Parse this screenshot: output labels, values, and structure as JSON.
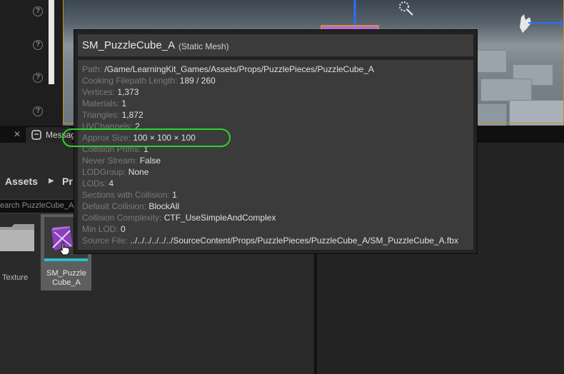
{
  "message_tab": {
    "label": "Messag"
  },
  "breadcrumb": {
    "root": "Assets",
    "next": "Pr"
  },
  "search": {
    "text": "earch PuzzleCube_A"
  },
  "content_items": {
    "texture_label": "Texture",
    "asset_label": "SM_Puzzle Cube_A"
  },
  "tooltip": {
    "title": "SM_PuzzleCube_A",
    "type": "(Static Mesh)",
    "rows": [
      {
        "key": "Path:",
        "value": "/Game/LearningKit_Games/Assets/Props/PuzzlePieces/PuzzleCube_A"
      },
      {
        "key": "Cooking Filepath Length:",
        "value": "189 / 260"
      },
      {
        "key": "Vertices:",
        "value": "1,373"
      },
      {
        "key": "Materials:",
        "value": "1"
      },
      {
        "key": "Triangles:",
        "value": "1,872"
      },
      {
        "key": "UVChannels:",
        "value": "2"
      },
      {
        "key": "Approx Size:",
        "value": "100 × 100 × 100"
      },
      {
        "key": "Collision Prims:",
        "value": "1"
      },
      {
        "key": "Never Stream:",
        "value": "False"
      },
      {
        "key": "LODGroup:",
        "value": "None"
      },
      {
        "key": "LODs:",
        "value": "4"
      },
      {
        "key": "Sections with Collision:",
        "value": "1"
      },
      {
        "key": "Default Collision:",
        "value": "BlockAll"
      },
      {
        "key": "Collision Complexity:",
        "value": "CTF_UseSimpleAndComplex"
      },
      {
        "key": "Min LOD:",
        "value": "0"
      },
      {
        "key": "Source File:",
        "value": "../../../../../../SourceContent/Props/PuzzlePieces/PuzzleCube_A/SM_PuzzleCube_A.fbx"
      }
    ]
  },
  "colors": {
    "highlight": "#2ed12e",
    "viewport_border": "#c8901a",
    "asset_bar": "#26c0c8"
  }
}
